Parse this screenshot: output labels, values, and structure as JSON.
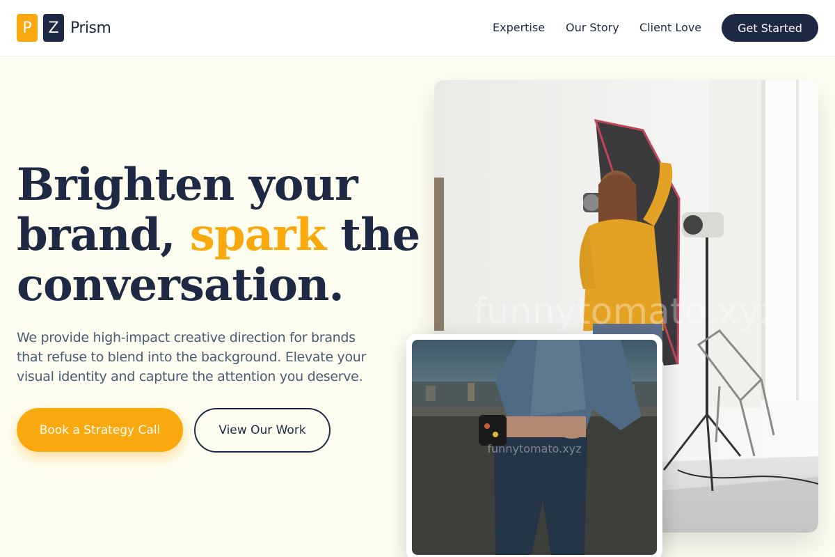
{
  "brand": {
    "tile_p": "P",
    "tile_z": "Z",
    "name": "Prism",
    "primary_color": "#f9a90e",
    "dark_color": "#1e2a44"
  },
  "nav": {
    "items": [
      {
        "label": "Expertise"
      },
      {
        "label": "Our Story"
      },
      {
        "label": "Client Love"
      }
    ],
    "cta_label": "Get Started"
  },
  "hero": {
    "headline_part1": "Brighten your brand, ",
    "headline_accent": "spark",
    "headline_part2": " the conversation.",
    "description": "We provide high-impact creative direction for brands that refuse to blend into the background. Elevate your visual identity and capture the attention you deserve.",
    "primary_button": "Book a Strategy Call",
    "secondary_button": "View Our Work"
  },
  "images": {
    "main_watermark": "funnytomato.xyz",
    "secondary_watermark": "funnytomato.xyz"
  }
}
